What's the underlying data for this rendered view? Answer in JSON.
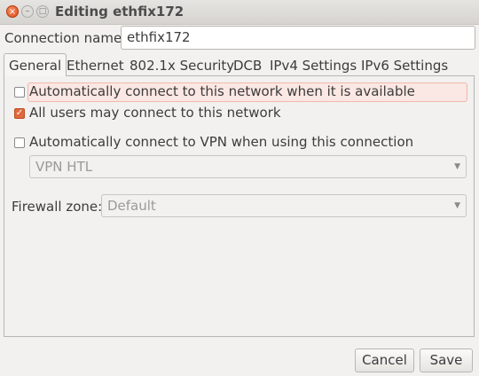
{
  "window": {
    "title": "Editing ethfix172"
  },
  "connection_name": {
    "label": "Connection name:",
    "value": "ethfix172"
  },
  "tabs": [
    {
      "label": "General",
      "active": true
    },
    {
      "label": "Ethernet"
    },
    {
      "label": "802.1x Security"
    },
    {
      "label": "DCB"
    },
    {
      "label": "IPv4 Settings"
    },
    {
      "label": "IPv6 Settings"
    }
  ],
  "general": {
    "auto_connect": {
      "label": "Automatically connect to this network when it is available",
      "checked": false
    },
    "all_users": {
      "label": "All users may connect to this network",
      "checked": true
    },
    "auto_vpn": {
      "label": "Automatically connect to VPN when using this connection",
      "checked": false
    },
    "vpn_select": {
      "value": "VPN HTL"
    },
    "firewall": {
      "label": "Firewall zone:",
      "value": "Default"
    }
  },
  "buttons": {
    "cancel": "Cancel",
    "save": "Save"
  },
  "colors": {
    "accent": "#e0683c",
    "titlebar": "#dedcd9"
  }
}
